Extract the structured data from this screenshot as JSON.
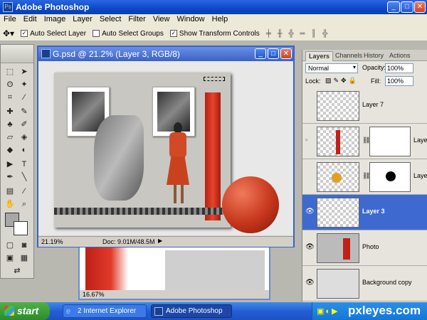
{
  "app_title": "Adobe Photoshop",
  "menu": [
    "File",
    "Edit",
    "Image",
    "Layer",
    "Select",
    "Filter",
    "View",
    "Window",
    "Help"
  ],
  "options": {
    "auto_select_layer": "Auto Select Layer",
    "auto_select_groups": "Auto Select Groups",
    "show_transform": "Show Transform Controls"
  },
  "doc": {
    "title": "G.psd @ 21.2% (Layer 3, RGB/8)",
    "zoom": "21.19%",
    "docsize": "Doc: 9.01M/48.5M"
  },
  "back_doc": {
    "zoom": "16.67%"
  },
  "panel": {
    "tabs": [
      "Layers",
      "Channels",
      "History",
      "Actions"
    ],
    "blend_mode": "Normal",
    "opacity_label": "Opacity:",
    "opacity_value": "100%",
    "lock_label": "Lock:",
    "fill_label": "Fill:",
    "fill_value": "100%",
    "layers": [
      {
        "name": "Layer 7"
      },
      {
        "name": "Layer"
      },
      {
        "name": "Layer"
      },
      {
        "name": "Layer 3"
      },
      {
        "name": "Photo"
      },
      {
        "name": "Background copy"
      }
    ]
  },
  "taskbar": {
    "start": "start",
    "items": [
      "2 Internet Explorer",
      "Adobe Photoshop"
    ],
    "watermark": "pxleyes.com"
  },
  "colors": {
    "title_blue": "#0a49c9",
    "selection_blue": "#3e6ad0",
    "start_green": "#2e8b2b"
  }
}
